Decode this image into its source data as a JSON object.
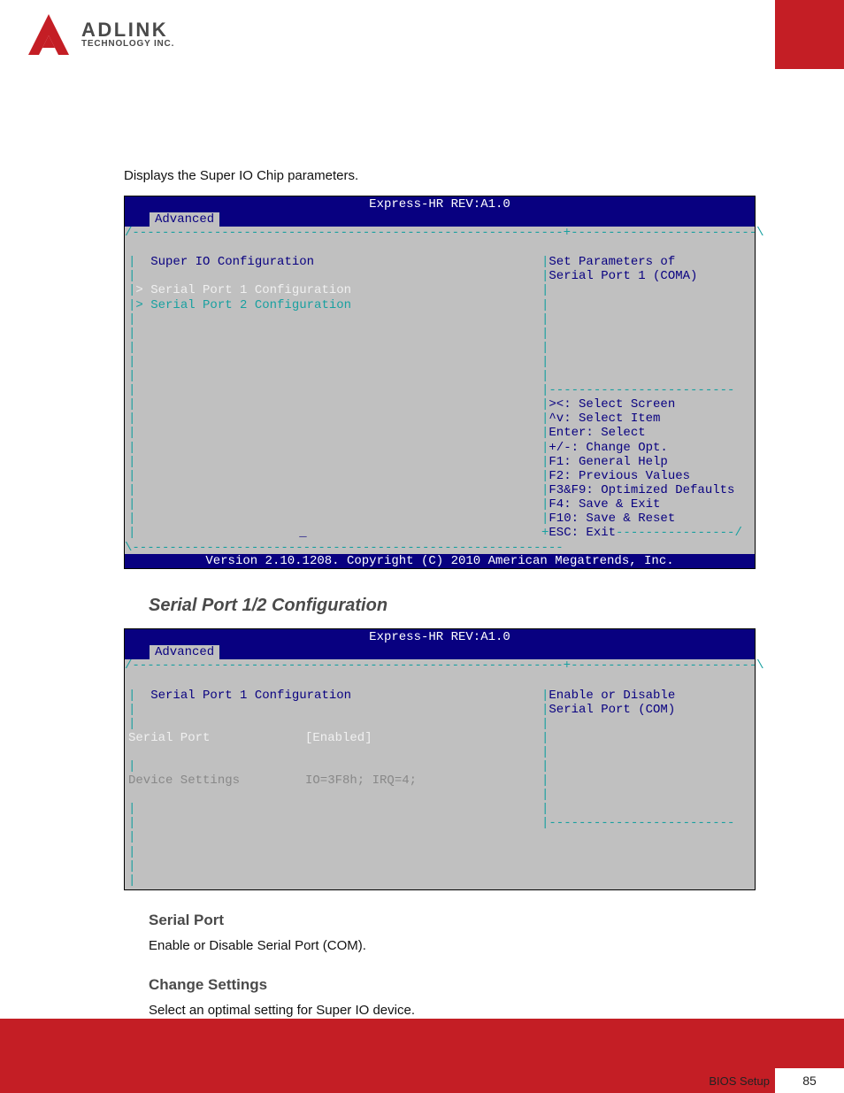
{
  "logo": {
    "name": "ADLINK",
    "sub": "TECHNOLOGY INC."
  },
  "intro": "Displays the Super IO Chip parameters.",
  "bios1": {
    "title": "Express-HR REV:A1.0",
    "tab": "Advanced",
    "left_heading": "Super IO Configuration",
    "items": [
      "> Serial Port 1 Configuration",
      "> Serial Port 2 Configuration"
    ],
    "help1": "Set Parameters of",
    "help2": "Serial Port 1 (COMA)",
    "nav": [
      "><: Select Screen",
      "^v: Select Item",
      "Enter: Select",
      "+/-: Change Opt.",
      "F1: General Help",
      "F2: Previous Values",
      "F3&F9: Optimized Defaults",
      "F4: Save & Exit",
      "F10: Save & Reset",
      "ESC: Exit"
    ],
    "footer": "Version 2.10.1208. Copyright (C) 2010 American Megatrends, Inc."
  },
  "subhead": "Serial Port 1/2 Configuration",
  "bios2": {
    "title": "Express-HR REV:A1.0",
    "tab": "Advanced",
    "left_heading": "Serial Port 1 Configuration",
    "row1_label": "Serial Port",
    "row1_value": "[Enabled]",
    "row2_label": "Device Settings",
    "row2_value": "IO=3F8h; IRQ=4;",
    "help1": "Enable or Disable",
    "help2": "Serial Port (COM)"
  },
  "sect1_head": "Serial Port",
  "sect1_body": "Enable or Disable Serial Port (COM).",
  "sect2_head": "Change Settings",
  "sect2_body": "Select an optimal setting for Super IO device.",
  "footer_label": "BIOS Setup",
  "page_num": "85"
}
